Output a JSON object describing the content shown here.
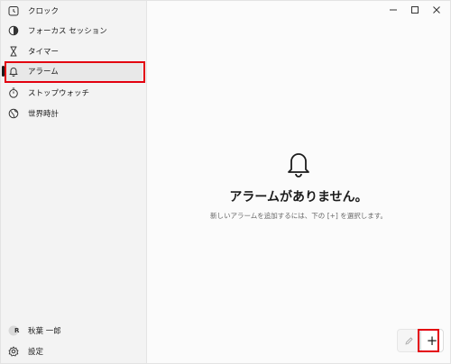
{
  "sidebar": {
    "items": [
      {
        "label": "クロック",
        "icon": "clock-icon"
      },
      {
        "label": "フォーカス セッション",
        "icon": "focus-icon"
      },
      {
        "label": "タイマー",
        "icon": "hourglass-icon"
      },
      {
        "label": "アラーム",
        "icon": "bell-icon",
        "selected": true
      },
      {
        "label": "ストップウォッチ",
        "icon": "stopwatch-icon"
      },
      {
        "label": "世界時計",
        "icon": "globe-icon"
      }
    ],
    "account": {
      "initial": "R",
      "label": "秋葉 一郎"
    },
    "settings": {
      "label": "設定",
      "icon": "gear-icon"
    }
  },
  "main": {
    "empty_title": "アラームがありません。",
    "empty_subtitle": "新しいアラームを追加するには、下の [+] を選択します。",
    "add_glyph": "+"
  },
  "colors": {
    "highlight": "#e3000f",
    "sidebar_bg": "#f3f3f3",
    "main_bg": "#fbfbfb"
  }
}
